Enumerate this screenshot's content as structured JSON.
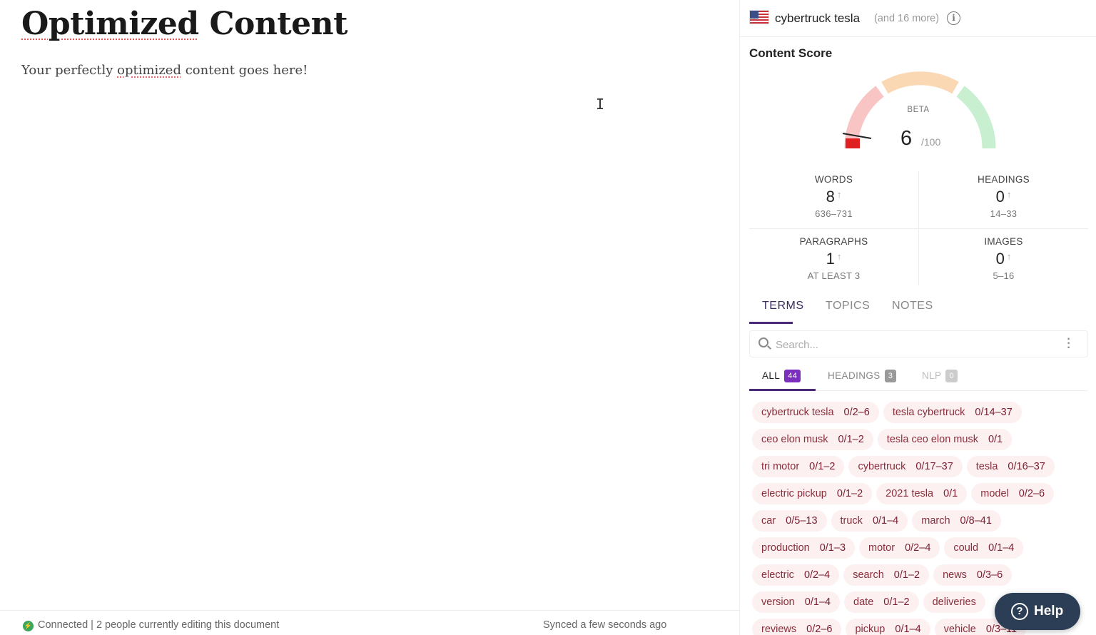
{
  "editor": {
    "title_word1": "Optimized",
    "title_word2": "Content",
    "body_pre": "Your perfectly ",
    "body_mark": "optimized",
    "body_post": " content goes here!"
  },
  "status": {
    "connected_text": "Connected | 2 people currently editing this document",
    "synced_text": "Synced a few seconds ago"
  },
  "keyword": {
    "main": "cybertruck tesla",
    "more": "(and 16 more)"
  },
  "score": {
    "label": "Content Score",
    "beta": "BETA",
    "value": "6",
    "max": "/100",
    "fraction": 0.06
  },
  "stats": [
    {
      "label": "WORDS",
      "value": "8",
      "range": "636–731"
    },
    {
      "label": "HEADINGS",
      "value": "0",
      "range": "14–33"
    },
    {
      "label": "PARAGRAPHS",
      "value": "1",
      "range": "AT LEAST 3"
    },
    {
      "label": "IMAGES",
      "value": "0",
      "range": "5–16"
    }
  ],
  "tabs": [
    "TERMS",
    "TOPICS",
    "NOTES"
  ],
  "search": {
    "placeholder": "Search..."
  },
  "filters": [
    {
      "label": "ALL",
      "count": "44"
    },
    {
      "label": "HEADINGS",
      "count": "3"
    },
    {
      "label": "NLP",
      "count": "0"
    }
  ],
  "terms": [
    [
      {
        "term": "cybertruck tesla",
        "count": "0/2–6"
      },
      {
        "term": "tesla cybertruck",
        "count": "0/14–37"
      }
    ],
    [
      {
        "term": "ceo elon musk",
        "count": "0/1–2"
      },
      {
        "term": "tesla ceo elon musk",
        "count": "0/1"
      }
    ],
    [
      {
        "term": "tri motor",
        "count": "0/1–2"
      },
      {
        "term": "cybertruck",
        "count": "0/17–37"
      },
      {
        "term": "tesla",
        "count": "0/16–37"
      }
    ],
    [
      {
        "term": "electric pickup",
        "count": "0/1–2"
      },
      {
        "term": "2021 tesla",
        "count": "0/1"
      },
      {
        "term": "model",
        "count": "0/2–6"
      }
    ],
    [
      {
        "term": "car",
        "count": "0/5–13"
      },
      {
        "term": "truck",
        "count": "0/1–4"
      },
      {
        "term": "march",
        "count": "0/8–41"
      }
    ],
    [
      {
        "term": "production",
        "count": "0/1–3"
      },
      {
        "term": "motor",
        "count": "0/2–4"
      },
      {
        "term": "could",
        "count": "0/1–4"
      }
    ],
    [
      {
        "term": "electric",
        "count": "0/2–4"
      },
      {
        "term": "search",
        "count": "0/1–2"
      },
      {
        "term": "news",
        "count": "0/3–6"
      }
    ],
    [
      {
        "term": "version",
        "count": "0/1–4"
      },
      {
        "term": "date",
        "count": "0/1–2"
      },
      {
        "term": "deliveries",
        "count": ""
      }
    ],
    [
      {
        "term": "reviews",
        "count": "0/2–6"
      },
      {
        "term": "pickup",
        "count": "0/1–4"
      },
      {
        "term": "vehicle",
        "count": "0/3–11"
      }
    ]
  ],
  "help": {
    "label": "Help"
  },
  "colors": {
    "accent": "#4b2a7a",
    "all_badge": "#7b2fbf",
    "headings_badge": "#9a9a9a",
    "nlp_badge": "#cccccc",
    "gauge_red": "#f8c4c4",
    "gauge_orange": "#fbd8b4",
    "gauge_green": "#c8efcf",
    "needle": "#e02020"
  }
}
